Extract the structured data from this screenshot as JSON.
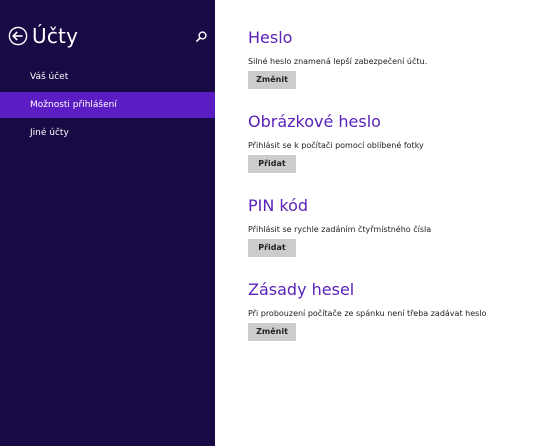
{
  "sidebar": {
    "title": "Účty",
    "back_icon": "back-arrow-circle-icon",
    "search_icon": "search-icon",
    "items": [
      {
        "label": "Váš účet",
        "selected": false
      },
      {
        "label": "Možnosti přihlášení",
        "selected": true
      },
      {
        "label": "Jiné účty",
        "selected": false
      }
    ]
  },
  "sections": [
    {
      "title": "Heslo",
      "description": "Silné heslo znamená lepší zabezpečení účtu.",
      "button_label": "Změnit"
    },
    {
      "title": "Obrázkové heslo",
      "description": "Přihlásit se k počítači pomocí oblíbené fotky",
      "button_label": "Přidat"
    },
    {
      "title": "PIN kód",
      "description": "Přihlásit se rychle zadáním čtyřmístného čísla",
      "button_label": "Přidat"
    },
    {
      "title": "Zásady hesel",
      "description": "Při probouzení počítače ze spánku není třeba zadávat heslo",
      "button_label": "Změnit"
    }
  ],
  "colors": {
    "sidebar_background": "#180a45",
    "selected_item": "#5b1cc4",
    "accent_heading": "#5a22b8",
    "button_background": "#cccccc"
  }
}
